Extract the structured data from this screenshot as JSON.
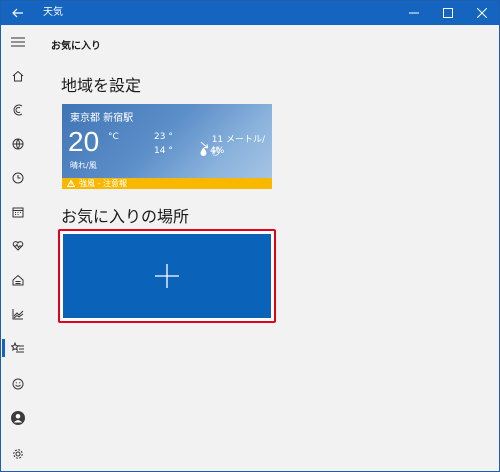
{
  "app": {
    "title": "天気"
  },
  "page": {
    "title": "お気に入り"
  },
  "sections": {
    "set_location": "地域を設定",
    "favorite_places": "お気に入りの場所"
  },
  "location_card": {
    "city": "東京都 新宿駅",
    "temperature": "20",
    "unit": "°C",
    "condition": "晴れ/風",
    "high": "23 °",
    "low": "14 °",
    "wind": "11 メートル/秒",
    "precip": "4%",
    "warning": "強風 - 注意報"
  },
  "colors": {
    "accent": "#1565c0",
    "add_tile": "#0a63b8",
    "highlight_border": "#e0001b",
    "warning": "#f9b800"
  },
  "nav": {
    "items": [
      "home-icon",
      "forecast-icon",
      "map-icon",
      "history-icon",
      "calendar-icon",
      "health-icon",
      "weather-icon",
      "charts-icon",
      "favorites-icon",
      "feedback-icon",
      "account-icon",
      "settings-icon"
    ],
    "active": "favorites-icon"
  }
}
